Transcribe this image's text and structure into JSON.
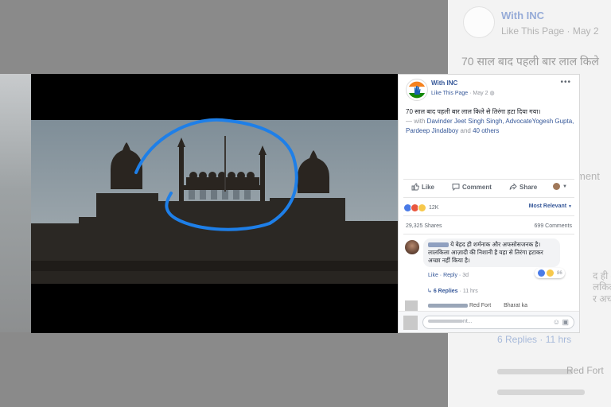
{
  "post": {
    "page_name": "With INC",
    "like_page": "Like This Page",
    "date": "May 2",
    "more": "•••",
    "text_main": "70 साल बाद पहली बार लाल किले से तिरंगा हटा दिया गया।",
    "with_prefix": "— with ",
    "tagged": "Davinder Jeet Singh Singh, AdvocateYogesh Gupta, Pardeep Jindalboy",
    "and": " and ",
    "others": "40 others"
  },
  "actions": {
    "like": "Like",
    "comment": "Comment",
    "share": "Share"
  },
  "stats": {
    "reactions": "12K",
    "sort": "Most Relevant",
    "shares": "29,325 Shares",
    "comments": "699 Comments"
  },
  "comment1": {
    "text": "ये बेहद ही शर्मनाक और अफसोसजनक है। लालकिला आज़ादी की निशानी है यहा से तिरंगा हटाकर अच्छा नहीं किया है।",
    "like": "Like",
    "reply": "Reply",
    "time": "3d",
    "reaction_count": "86",
    "replies": "6 Replies",
    "replies_time": "11 hrs"
  },
  "comment2": {
    "text_a": "Red Fort",
    "text_b": "Bharat ka"
  },
  "write": {
    "placeholder": "nt..."
  },
  "background": {
    "name": "With INC",
    "like": "Like This Page",
    "date": "May 2",
    "text": "70 साल बाद पहली बार लाल किले",
    "comment": "ment",
    "replies": "6 Replies · 11 hrs",
    "red_fort": "Red Fort",
    "hindi1": "द ही श",
    "hindi2": "लकिला",
    "hindi3": "र अच्"
  },
  "colors": {
    "fb_blue": "#365899",
    "annotation": "#1e7fe8",
    "inc_orange": "#f5821f",
    "inc_green": "#138808"
  }
}
